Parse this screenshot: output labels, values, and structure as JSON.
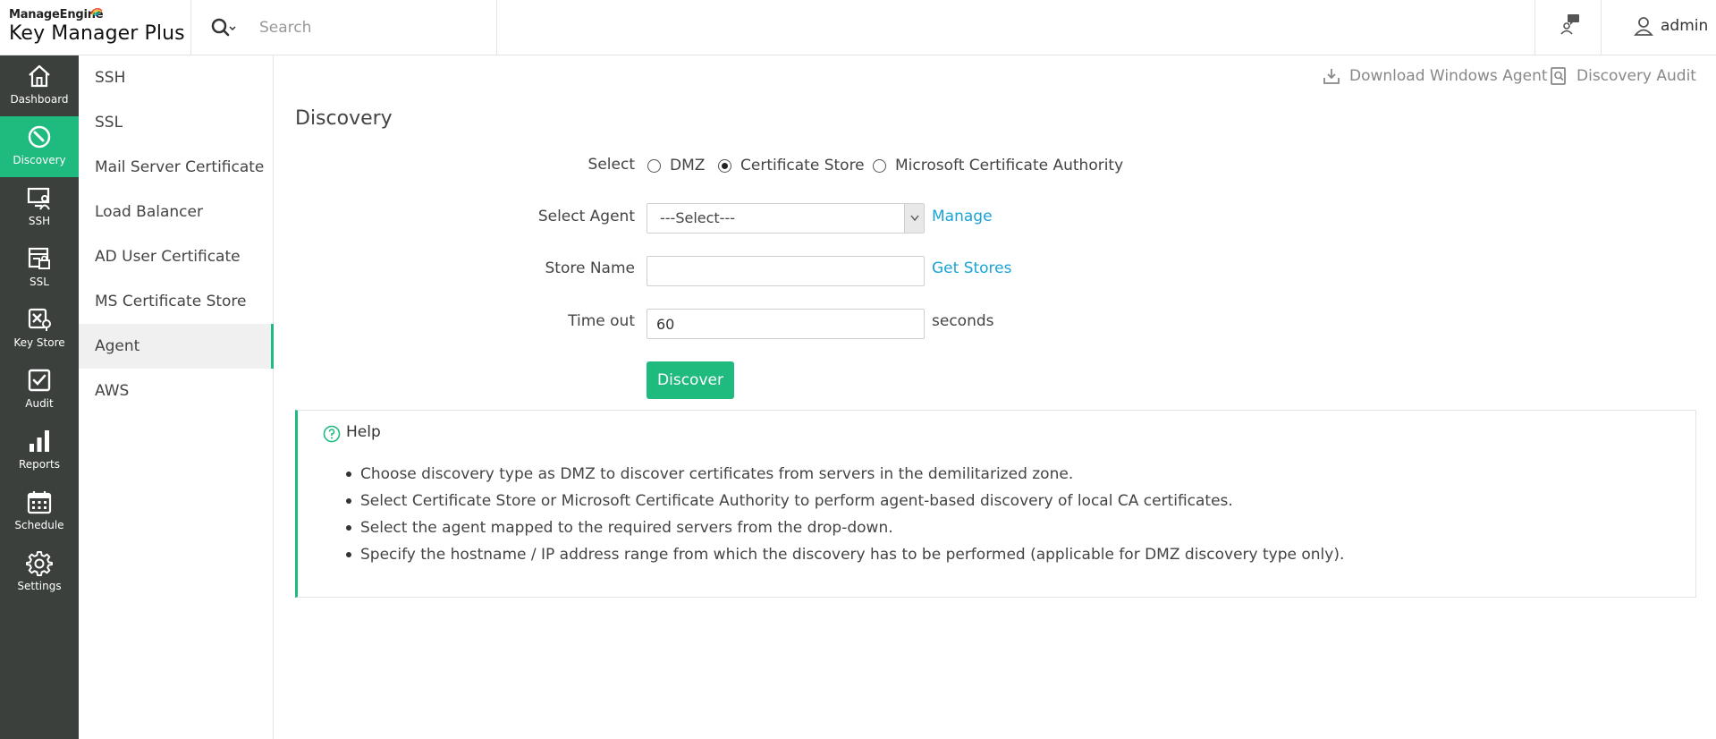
{
  "header": {
    "brand": "ManageEngine",
    "product": "Key Manager Plus",
    "search_placeholder": "Search",
    "user": "admin"
  },
  "nav": {
    "items": [
      {
        "label": "Dashboard",
        "icon": "home-icon"
      },
      {
        "label": "Discovery",
        "icon": "discovery-icon",
        "active": true
      },
      {
        "label": "SSH",
        "icon": "ssh-icon"
      },
      {
        "label": "SSL",
        "icon": "ssl-icon"
      },
      {
        "label": "Key Store",
        "icon": "key-store-icon"
      },
      {
        "label": "Audit",
        "icon": "audit-icon"
      },
      {
        "label": "Reports",
        "icon": "reports-icon"
      },
      {
        "label": "Schedule",
        "icon": "calendar-icon"
      },
      {
        "label": "Settings",
        "icon": "gear-icon"
      }
    ]
  },
  "subnav": {
    "items": [
      {
        "label": "SSH"
      },
      {
        "label": "SSL"
      },
      {
        "label": "Mail Server Certificate"
      },
      {
        "label": "Load Balancer"
      },
      {
        "label": "AD User Certificate"
      },
      {
        "label": "MS Certificate Store"
      },
      {
        "label": "Agent",
        "active": true
      },
      {
        "label": "AWS"
      }
    ]
  },
  "main": {
    "actions": {
      "download_agent": "Download Windows Agent",
      "discovery_audit": "Discovery Audit"
    },
    "title": "Discovery",
    "form": {
      "select_label": "Select",
      "radio_options": [
        "DMZ",
        "Certificate Store",
        "Microsoft Certificate Authority"
      ],
      "radio_selected": "Certificate Store",
      "agent_label": "Select Agent",
      "agent_value": "---Select---",
      "manage_link": "Manage",
      "store_label": "Store Name",
      "store_value": "",
      "get_stores_link": "Get Stores",
      "timeout_label": "Time out",
      "timeout_value": "60",
      "timeout_unit": "seconds",
      "discover_button": "Discover"
    },
    "help": {
      "title": "Help",
      "items": [
        "Choose discovery type as DMZ to discover certificates from servers in the demilitarized zone.",
        "Select Certificate Store or Microsoft Certificate Authority to perform agent-based discovery of local CA certificates.",
        "Select the agent mapped to the required servers from the drop-down.",
        "Specify the hostname / IP address range from which the discovery has to be performed (applicable for DMZ discovery type only)."
      ]
    }
  },
  "colors": {
    "accent": "#1fba7e",
    "nav_bg": "#3b403d",
    "link": "#1aa3d6"
  }
}
